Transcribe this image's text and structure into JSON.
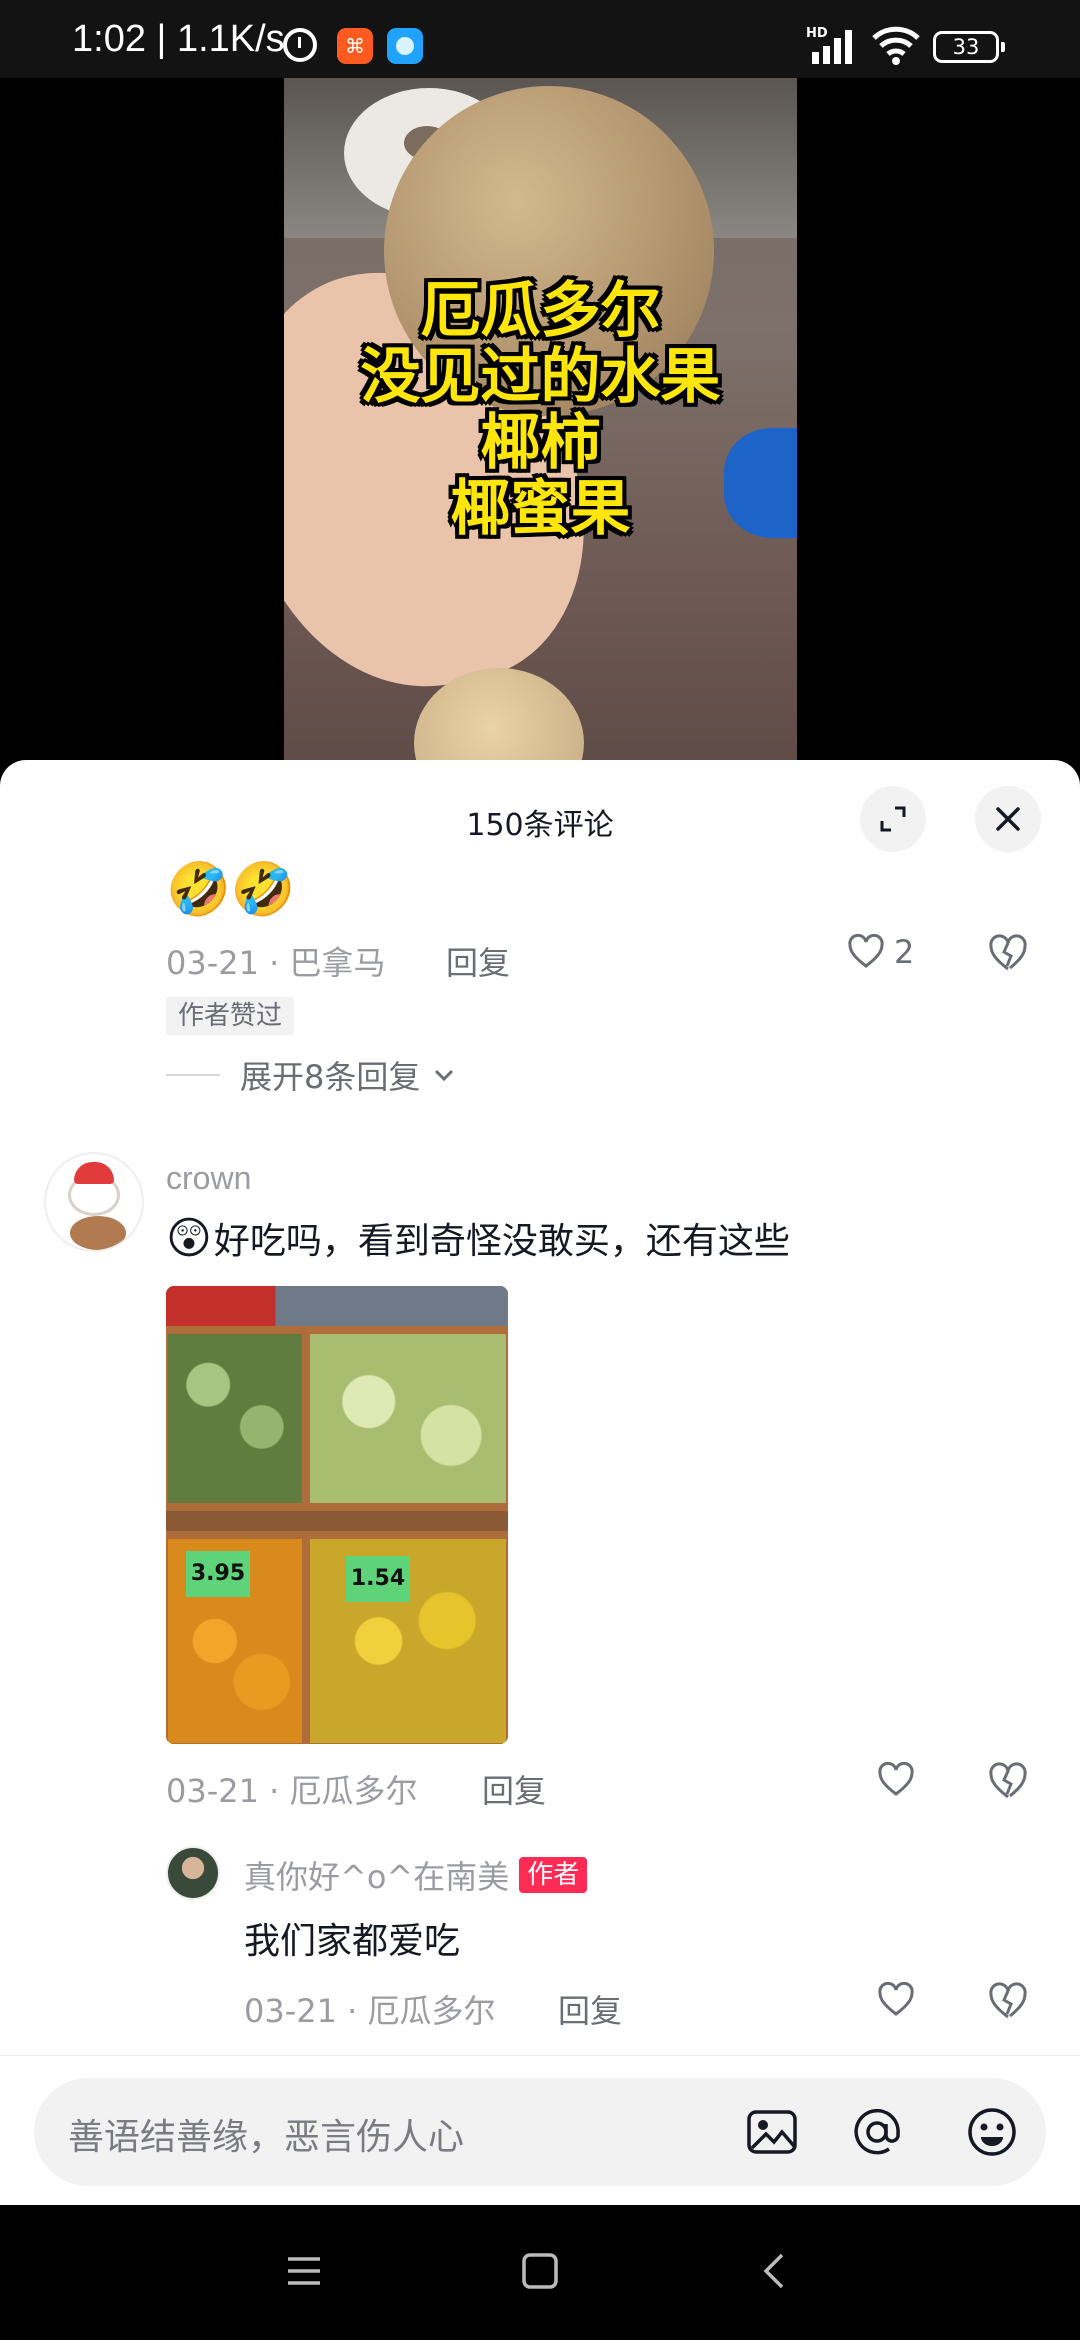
{
  "status_bar": {
    "time_speed": "1:02 | 1.1K/s",
    "app_icon_1": "小红书",
    "network_badge": "HD",
    "battery": "33"
  },
  "video": {
    "caption_lines": [
      "厄瓜多尔",
      "没见过的水果",
      "椰柿",
      "椰蜜果"
    ]
  },
  "panel": {
    "title": "150条评论"
  },
  "comment1": {
    "emojis": "🤣🤣",
    "meta": "03-21 · 巴拿马",
    "reply_label": "回复",
    "like_count": "2",
    "author_liked_label": "作者赞过",
    "expand_label": "展开8条回复"
  },
  "comment2": {
    "username": "crown",
    "emoji": "😲",
    "text": "好吃吗，看到奇怪没敢买，还有这些",
    "image_tags": [
      "3.95",
      "1.54"
    ],
    "meta": "03-21 · 厄瓜多尔",
    "reply_label": "回复"
  },
  "reply": {
    "username": "真你好^o^在南美",
    "badge": "作者",
    "text": "我们家都爱吃",
    "meta": "03-21 · 厄瓜多尔",
    "reply_label": "回复"
  },
  "input": {
    "placeholder": "善语结善缘，恶言伤人心"
  },
  "icons": {
    "expand": "expand-icon",
    "close": "close-icon",
    "like": "heart-icon",
    "dislike": "broken-heart-icon",
    "image": "image-icon",
    "at": "at-icon",
    "emoji": "smiley-icon",
    "nav_menu": "menu-icon",
    "nav_home": "home-icon",
    "nav_back": "back-icon"
  },
  "colors": {
    "accent": "#fe2c55",
    "caption_text": "#ffe60a"
  }
}
